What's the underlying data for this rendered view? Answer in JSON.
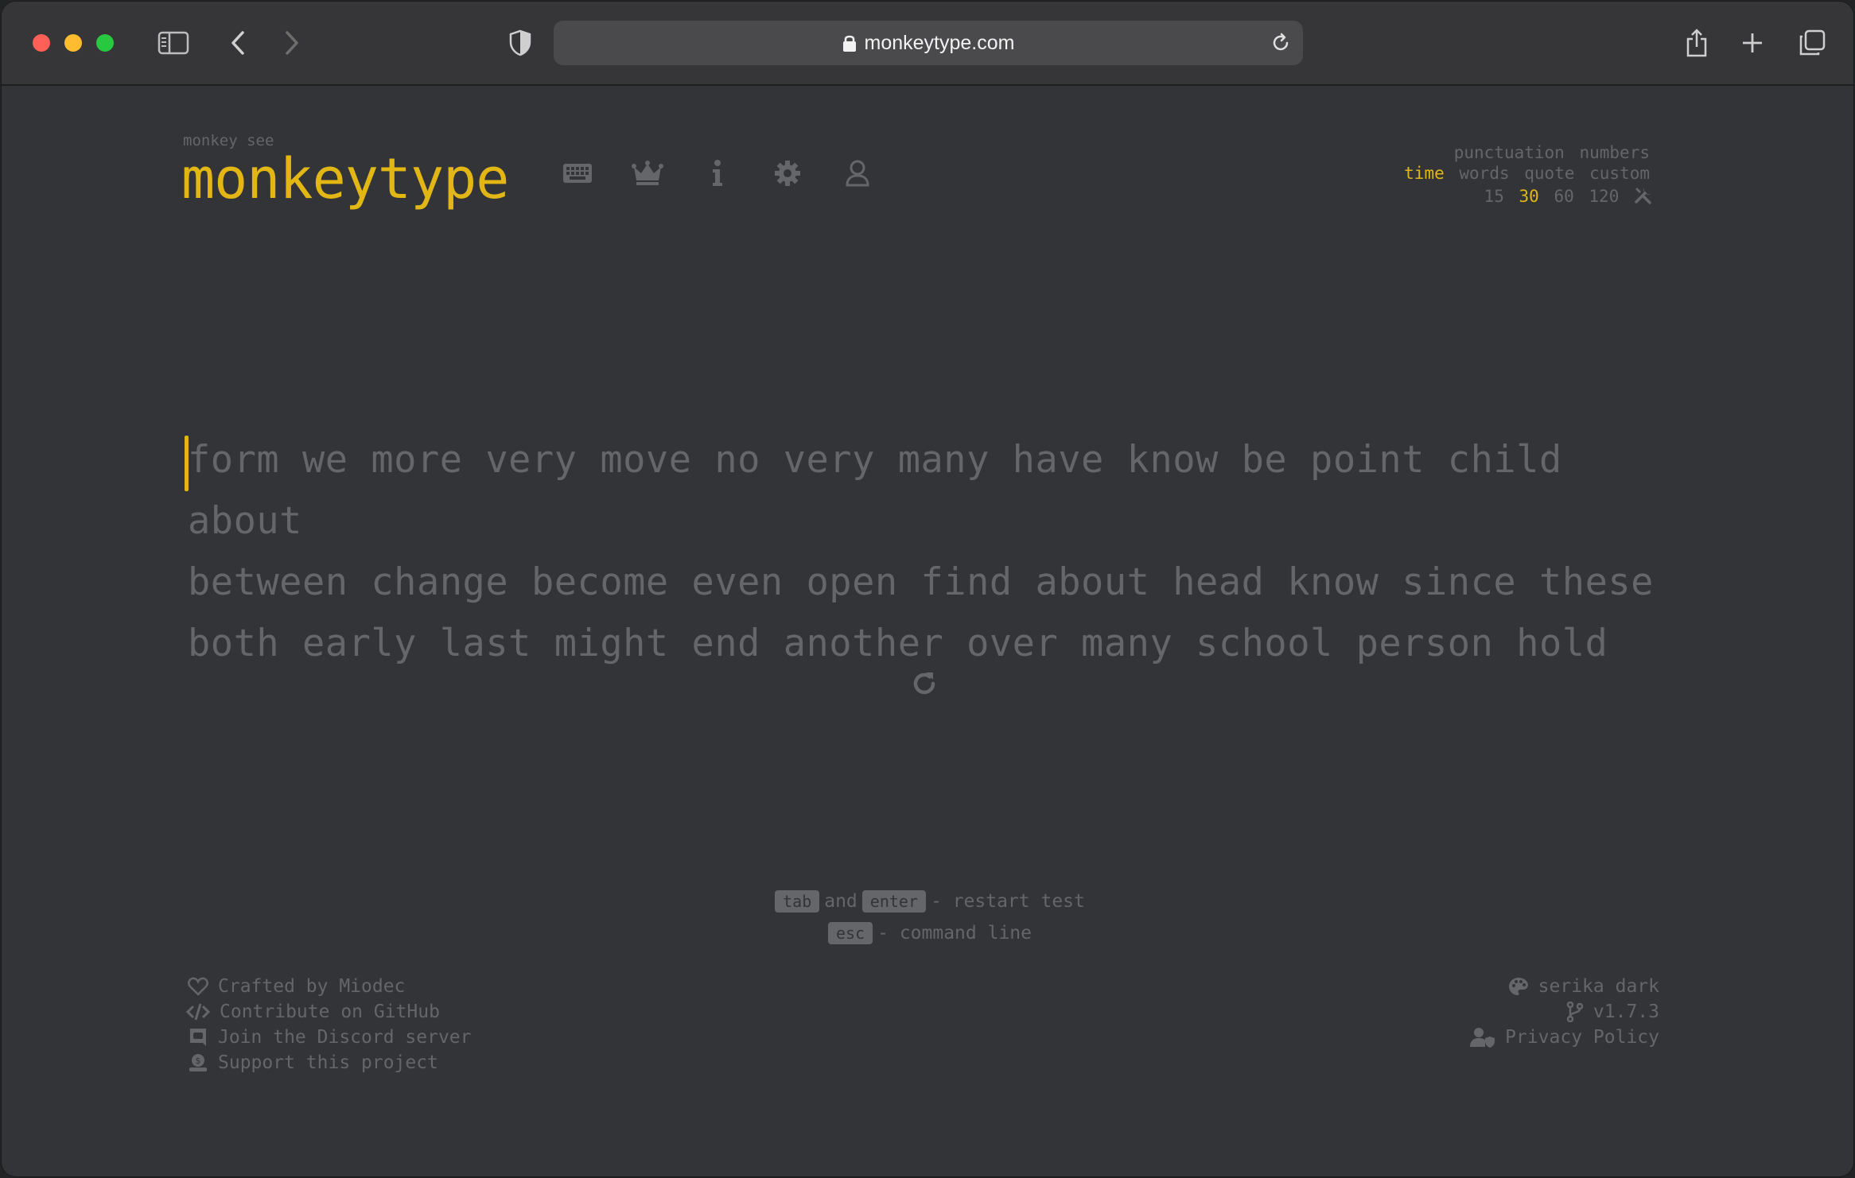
{
  "browser": {
    "url": "monkeytype.com"
  },
  "header": {
    "logo_small": "monkey see",
    "logo": "monkeytype",
    "nav_icons": [
      "keyboard-icon",
      "crown-icon",
      "info-icon",
      "gear-icon",
      "user-icon"
    ]
  },
  "config": {
    "row1": [
      "punctuation",
      "numbers"
    ],
    "row2": [
      "time",
      "words",
      "quote",
      "custom"
    ],
    "row2_active": "time",
    "row3": [
      "15",
      "30",
      "60",
      "120"
    ],
    "row3_active": "30"
  },
  "test": {
    "words_line1": "form we more very move no very many have know be point child about",
    "words_line2": "between change become even open find about head know since these",
    "words_line3": "both early last might end another over many school person hold"
  },
  "hints": {
    "key_tab": "tab",
    "and": "and",
    "key_enter": "enter",
    "restart": "- restart test",
    "key_esc": "esc",
    "command": "- command line"
  },
  "footer": {
    "left": [
      {
        "icon": "heart-icon",
        "label": "Crafted by Miodec"
      },
      {
        "icon": "code-icon",
        "label": "Contribute on GitHub"
      },
      {
        "icon": "discord-icon",
        "label": "Join the Discord server"
      },
      {
        "icon": "donate-icon",
        "label": "Support this project"
      }
    ],
    "right": [
      {
        "icon": "palette-icon",
        "label": "serika dark"
      },
      {
        "icon": "branch-icon",
        "label": "v1.7.3"
      },
      {
        "icon": "privacy-icon",
        "label": "Privacy Policy"
      }
    ]
  },
  "colors": {
    "background": "#323437",
    "accent": "#e2b714",
    "sub": "#646669"
  }
}
